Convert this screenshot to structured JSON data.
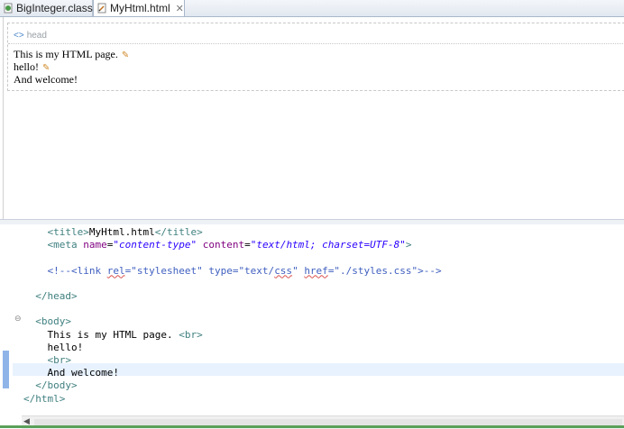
{
  "tabs": [
    {
      "label": "BigInteger.class",
      "icon": "class-file-icon",
      "active": false
    },
    {
      "label": "MyHtml.html",
      "icon": "html-file-icon",
      "active": true,
      "close": "✕"
    }
  ],
  "design": {
    "head_label": "head",
    "preview_lines": [
      "This is my HTML page.",
      "hello!",
      "And welcome!"
    ]
  },
  "source": {
    "lines": [
      {
        "indent": "    ",
        "tokens": [
          [
            "tg",
            "<title>"
          ],
          [
            "tx",
            "MyHtml.html"
          ],
          [
            "tg",
            "</title>"
          ]
        ]
      },
      {
        "indent": "    ",
        "tokens": [
          [
            "tg",
            "<meta "
          ],
          [
            "an",
            "name"
          ],
          [
            "tx",
            "="
          ],
          [
            "av",
            "\"content-type\""
          ],
          [
            "tx",
            " "
          ],
          [
            "an",
            "content"
          ],
          [
            "tx",
            "="
          ],
          [
            "av",
            "\"text/html; charset=UTF-8\""
          ],
          [
            "tg",
            ">"
          ]
        ]
      },
      {
        "indent": "",
        "tokens": []
      },
      {
        "indent": "    ",
        "tokens": [
          [
            "cm",
            "<!--<link "
          ],
          [
            "cmsq",
            "rel"
          ],
          [
            "cm",
            "=\"stylesheet\" type=\"text/"
          ],
          [
            "cmsq",
            "css"
          ],
          [
            "cm",
            "\" "
          ],
          [
            "cmsq",
            "href"
          ],
          [
            "cm",
            "=\"./styles.css\">-->"
          ]
        ]
      },
      {
        "indent": "",
        "tokens": []
      },
      {
        "indent": "  ",
        "tokens": [
          [
            "tg",
            "</head>"
          ]
        ]
      },
      {
        "indent": "",
        "tokens": []
      },
      {
        "indent": "  ",
        "tokens": [
          [
            "tg",
            "<body>"
          ]
        ]
      },
      {
        "indent": "    ",
        "tokens": [
          [
            "tx",
            "This is my HTML page. "
          ],
          [
            "tg",
            "<br>"
          ]
        ]
      },
      {
        "indent": "    ",
        "tokens": [
          [
            "tx",
            "hello!"
          ]
        ]
      },
      {
        "indent": "    ",
        "tokens": [
          [
            "tg",
            "<br>"
          ]
        ]
      },
      {
        "indent": "    ",
        "tokens": [
          [
            "tx",
            "And welcome!"
          ]
        ]
      },
      {
        "indent": "  ",
        "tokens": [
          [
            "tg",
            "</body>"
          ]
        ]
      },
      {
        "indent": "",
        "tokens": [
          [
            "tg",
            "</html>"
          ]
        ]
      }
    ]
  },
  "colors": {
    "tag": "#3f7f7f",
    "attr_name": "#7f007f",
    "attr_value": "#2a00ff",
    "comment": "#3f5fbf"
  }
}
